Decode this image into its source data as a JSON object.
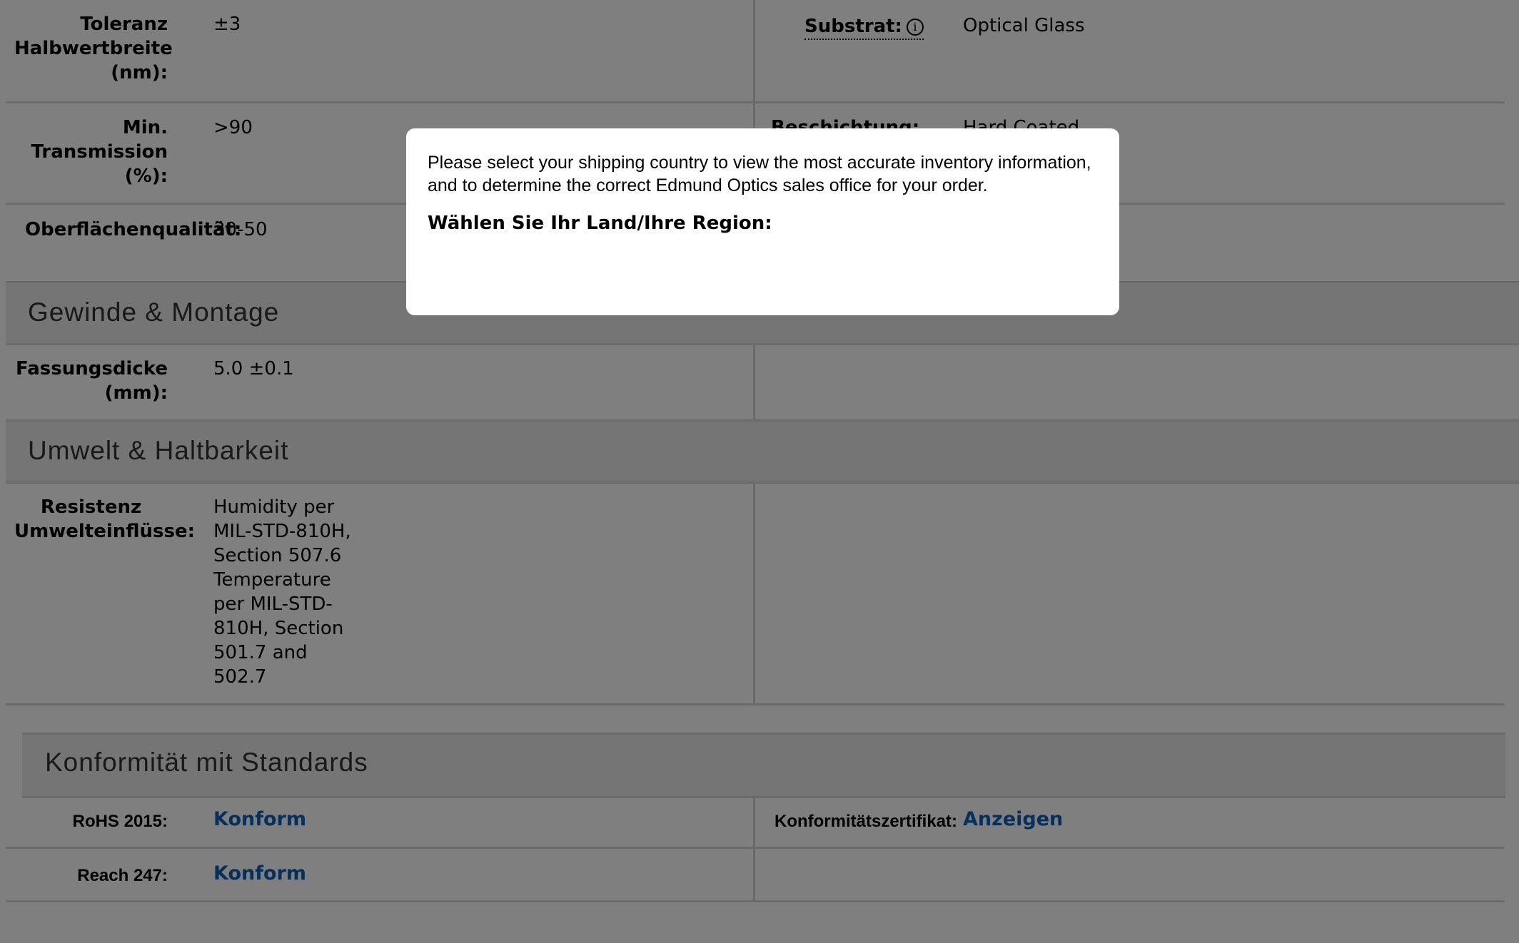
{
  "specs": {
    "toleranz": {
      "label": "Toleranz\nHalbwertbreite\n(nm):",
      "value": "±3"
    },
    "substrat": {
      "label": "Substrat:",
      "info_icon": "info-icon",
      "value": "Optical Glass"
    },
    "transmission": {
      "label": "Min.\nTransmission\n(%):",
      "value": ">90"
    },
    "beschichtung": {
      "label": "Beschichtung:",
      "value": "Hard Coated"
    },
    "oberflaeche": {
      "label": "Oberflächenqualität:",
      "value": "30-50"
    }
  },
  "sections": {
    "gewinde": {
      "title": "Gewinde & Montage",
      "fassungsdicke": {
        "label": "Fassungsdicke\n(mm):",
        "value": "5.0 ±0.1"
      }
    },
    "umwelt": {
      "title": "Umwelt & Haltbarkeit",
      "resistenz": {
        "label": "Resistenz\nUmwelteinflüsse:",
        "value": "Humidity per\nMIL-STD-810H,\nSection 507.6\nTemperature\nper MIL-STD-\n810H, Section\n501.7 and\n502.7"
      }
    },
    "konformitaet": {
      "title": "Konformität mit Standards",
      "rohs": {
        "label": "RoHS 2015:",
        "value": "Konform"
      },
      "zertifikat": {
        "label": "Konformitätszertifikat:",
        "value": "Anzeigen"
      },
      "reach": {
        "label": "Reach 247:",
        "value": "Konform"
      }
    }
  },
  "modal": {
    "message": "Please select your shipping country to view the most accurate inventory information, and to determine the correct Edmund Optics sales office for your order.",
    "region_label": "Wählen Sie Ihr Land/Ihre Region:"
  },
  "colors": {
    "link": "#0d5fb7",
    "overlay": "rgba(0,0,0,0.5)",
    "section_band": "#ebebeb"
  }
}
